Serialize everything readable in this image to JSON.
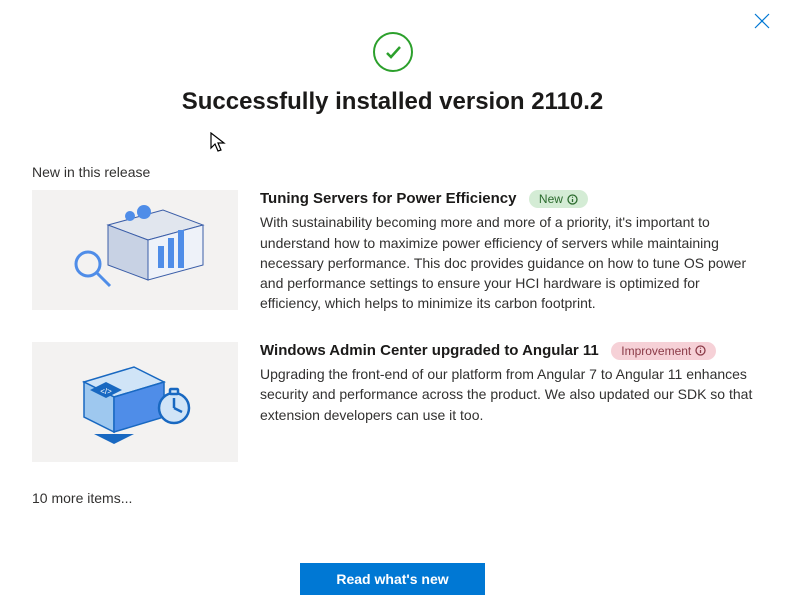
{
  "title": "Successfully installed version 2110.2",
  "section_label": "New in this release",
  "items": [
    {
      "title": "Tuning Servers for Power Efficiency",
      "badge": "New",
      "desc": "With sustainability becoming more and more of a priority, it's important to understand how to maximize power efficiency of servers while maintaining necessary performance. This doc provides guidance on how to tune OS power and performance settings to ensure your HCI hardware is optimized for efficiency, which helps to minimize its carbon footprint."
    },
    {
      "title": "Windows Admin Center upgraded to Angular 11",
      "badge": "Improvement",
      "desc": "Upgrading the front-end of our platform from Angular 7 to Angular 11 enhances security and performance across the product. We also updated our SDK so that extension developers can use it too."
    }
  ],
  "more_items": "10 more items...",
  "button": "Read what's new"
}
